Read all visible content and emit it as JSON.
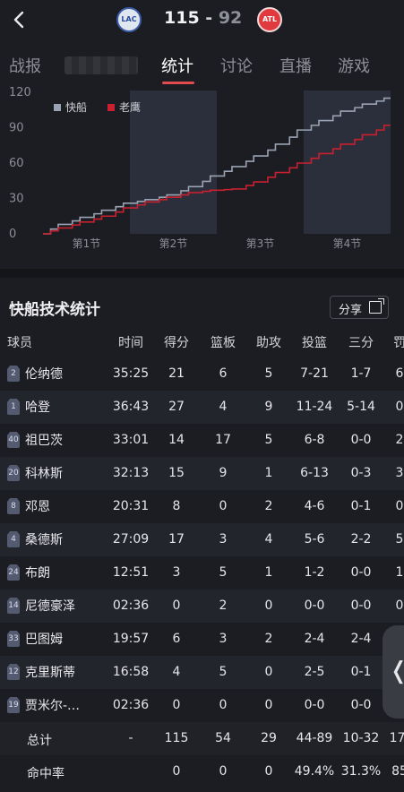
{
  "header": {
    "home_score": "115",
    "separator": "-",
    "away_score": "92",
    "home_logo_text": "LAC",
    "away_logo_text": "ATL",
    "back_icon": "chevron-left-icon"
  },
  "tabs": [
    {
      "label": "战报",
      "active": false
    },
    {
      "label": "",
      "active": false,
      "blurred": true
    },
    {
      "label": "统计",
      "active": true
    },
    {
      "label": "讨论",
      "active": false
    },
    {
      "label": "直播",
      "active": false
    },
    {
      "label": "游戏",
      "active": false
    }
  ],
  "chart_data": {
    "type": "line",
    "y_ticks": [
      "120",
      "90",
      "60",
      "30",
      "0"
    ],
    "ylim": [
      0,
      120
    ],
    "x_categories": [
      "第1节",
      "第2节",
      "第3节",
      "第4节"
    ],
    "legend": [
      "快船",
      "老鹰"
    ],
    "colors": {
      "快船": "#9aa3b3",
      "老鹰": "#c8202f"
    },
    "series": [
      {
        "name": "快船",
        "x": [
          0,
          3,
          6,
          9,
          12,
          15,
          18,
          21,
          24,
          27,
          30,
          33,
          36,
          39,
          42,
          45,
          48
        ],
        "values": [
          0,
          8,
          14,
          20,
          26,
          29,
          33,
          40,
          49,
          57,
          66,
          76,
          88,
          96,
          104,
          110,
          115
        ]
      },
      {
        "name": "老鹰",
        "x": [
          0,
          3,
          6,
          9,
          12,
          15,
          18,
          21,
          24,
          27,
          30,
          33,
          36,
          39,
          42,
          45,
          48
        ],
        "values": [
          0,
          5,
          10,
          15,
          22,
          27,
          31,
          35,
          37,
          38,
          44,
          52,
          60,
          68,
          76,
          84,
          92
        ]
      }
    ],
    "shaded_quarters": [
      "第2节",
      "第4节"
    ],
    "legend_position": "top-left"
  },
  "stats": {
    "title": "快船技术统计",
    "share_label": "分享",
    "columns": [
      "球员",
      "时间",
      "得分",
      "篮板",
      "助攻",
      "投篮",
      "三分",
      "罚"
    ],
    "players": [
      {
        "number": "2",
        "name": "伦纳德",
        "time": "35:25",
        "pts": "21",
        "reb": "6",
        "ast": "5",
        "fg": "7-21",
        "three": "1-7",
        "ft": "6"
      },
      {
        "number": "1",
        "name": "哈登",
        "time": "36:43",
        "pts": "27",
        "reb": "4",
        "ast": "9",
        "fg": "11-24",
        "three": "5-14",
        "ft": "0"
      },
      {
        "number": "40",
        "name": "祖巴茨",
        "time": "33:01",
        "pts": "14",
        "reb": "17",
        "ast": "5",
        "fg": "6-8",
        "three": "0-0",
        "ft": "2"
      },
      {
        "number": "20",
        "name": "科林斯",
        "time": "32:13",
        "pts": "15",
        "reb": "9",
        "ast": "1",
        "fg": "6-13",
        "three": "0-3",
        "ft": "3"
      },
      {
        "number": "8",
        "name": "邓恩",
        "time": "20:31",
        "pts": "8",
        "reb": "0",
        "ast": "2",
        "fg": "4-6",
        "three": "0-1",
        "ft": "0"
      },
      {
        "number": "4",
        "name": "桑德斯",
        "time": "27:09",
        "pts": "17",
        "reb": "3",
        "ast": "4",
        "fg": "5-6",
        "three": "2-2",
        "ft": "5"
      },
      {
        "number": "24",
        "name": "布朗",
        "time": "12:51",
        "pts": "3",
        "reb": "5",
        "ast": "1",
        "fg": "1-2",
        "three": "0-0",
        "ft": "1"
      },
      {
        "number": "14",
        "name": "尼德豪泽",
        "time": "02:36",
        "pts": "0",
        "reb": "2",
        "ast": "0",
        "fg": "0-0",
        "three": "0-0",
        "ft": "0"
      },
      {
        "number": "33",
        "name": "巴图姆",
        "time": "19:57",
        "pts": "6",
        "reb": "3",
        "ast": "2",
        "fg": "2-4",
        "three": "2-4",
        "ft": ""
      },
      {
        "number": "12",
        "name": "克里斯蒂",
        "time": "16:58",
        "pts": "4",
        "reb": "5",
        "ast": "0",
        "fg": "2-5",
        "three": "0-1",
        "ft": ""
      },
      {
        "number": "19",
        "name": "贾米尔-…",
        "time": "02:36",
        "pts": "0",
        "reb": "0",
        "ast": "0",
        "fg": "0-0",
        "three": "0-0",
        "ft": ""
      }
    ],
    "total": {
      "label": "总计",
      "time": "-",
      "pts": "115",
      "reb": "54",
      "ast": "29",
      "fg": "44-89",
      "three": "10-32",
      "ft": "17-"
    },
    "rate": {
      "label": "命中率",
      "time": "",
      "pts": "0",
      "reb": "0",
      "ast": "0",
      "fg": "49.4%",
      "three": "31.3%",
      "ft": "85"
    }
  },
  "side_handle": {
    "glyph": "❬"
  }
}
